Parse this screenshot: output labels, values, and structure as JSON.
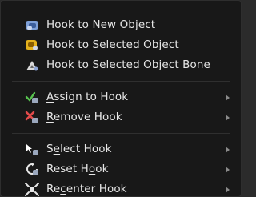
{
  "menu": {
    "groups": [
      [
        {
          "pre": "",
          "ul": "H",
          "post": "ook to New Object",
          "icon": "hook-new-object-icon",
          "submenu": false
        },
        {
          "pre": "Hook ",
          "ul": "t",
          "post": "o Selected Object",
          "icon": "hook-selected-object-icon",
          "submenu": false
        },
        {
          "pre": "Hook to ",
          "ul": "S",
          "post": "elected Object Bone",
          "icon": "hook-selected-bone-icon",
          "submenu": false
        }
      ],
      [
        {
          "pre": "",
          "ul": "A",
          "post": "ssign to Hook",
          "icon": "assign-hook-icon",
          "submenu": true
        },
        {
          "pre": "",
          "ul": "R",
          "post": "emove Hook",
          "icon": "remove-hook-icon",
          "submenu": true
        }
      ],
      [
        {
          "pre": "S",
          "ul": "e",
          "post": "lect Hook",
          "icon": "select-hook-icon",
          "submenu": true
        },
        {
          "pre": "Reset H",
          "ul": "o",
          "post": "ok",
          "icon": "reset-hook-icon",
          "submenu": true
        },
        {
          "pre": "Re",
          "ul": "c",
          "post": "enter Hook",
          "icon": "recenter-hook-icon",
          "submenu": true
        }
      ]
    ]
  },
  "colors": {
    "menu_bg": "#181818",
    "text": "#e6e6e6",
    "arrow": "#8a8a8a",
    "separator": "#2f2f2f"
  }
}
